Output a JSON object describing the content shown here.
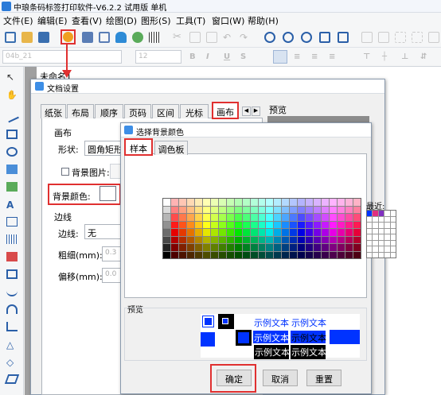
{
  "app": {
    "title": "中琅条码标签打印软件-V6.2.2 试用版 单机"
  },
  "menu": [
    "文件(E)",
    "编辑(E)",
    "查看(V)",
    "绘图(D)",
    "图形(S)",
    "工具(T)",
    "窗口(W)",
    "帮助(H)"
  ],
  "format_bar": {
    "font_value": "04b_21",
    "size_value": "12"
  },
  "canvas_tab": {
    "label": "未命名1"
  },
  "doc_dialog": {
    "title": "文档设置",
    "tabs": [
      "纸张",
      "布局",
      "顺序",
      "页码",
      "区间",
      "光标",
      "画布"
    ],
    "preview_label": "预览",
    "canvas_group": "画布",
    "shape_label": "形状:",
    "shape_value": "圆角矩形",
    "bg_image_label": "背景图片:",
    "bg_color_label": "背景颜色:",
    "line_group": "边线",
    "edge_label": "边线:",
    "edge_value": "无",
    "thickness_label": "粗细(mm):",
    "thickness_value": "0.3",
    "offset_label": "偏移(mm):",
    "offset_value": "0.0"
  },
  "color_dialog": {
    "title": "选择背景颜色",
    "tabs": [
      "样本",
      "调色板"
    ],
    "recent_label": "最近:",
    "preview_label": "预览",
    "sample_text": "示例文本",
    "buttons": {
      "ok": "确定",
      "cancel": "取消",
      "reset": "重置"
    }
  },
  "colors": {
    "highlight": "#e03030",
    "selection_blue": "#0033ff",
    "title_blue": "#3d8ee6"
  }
}
